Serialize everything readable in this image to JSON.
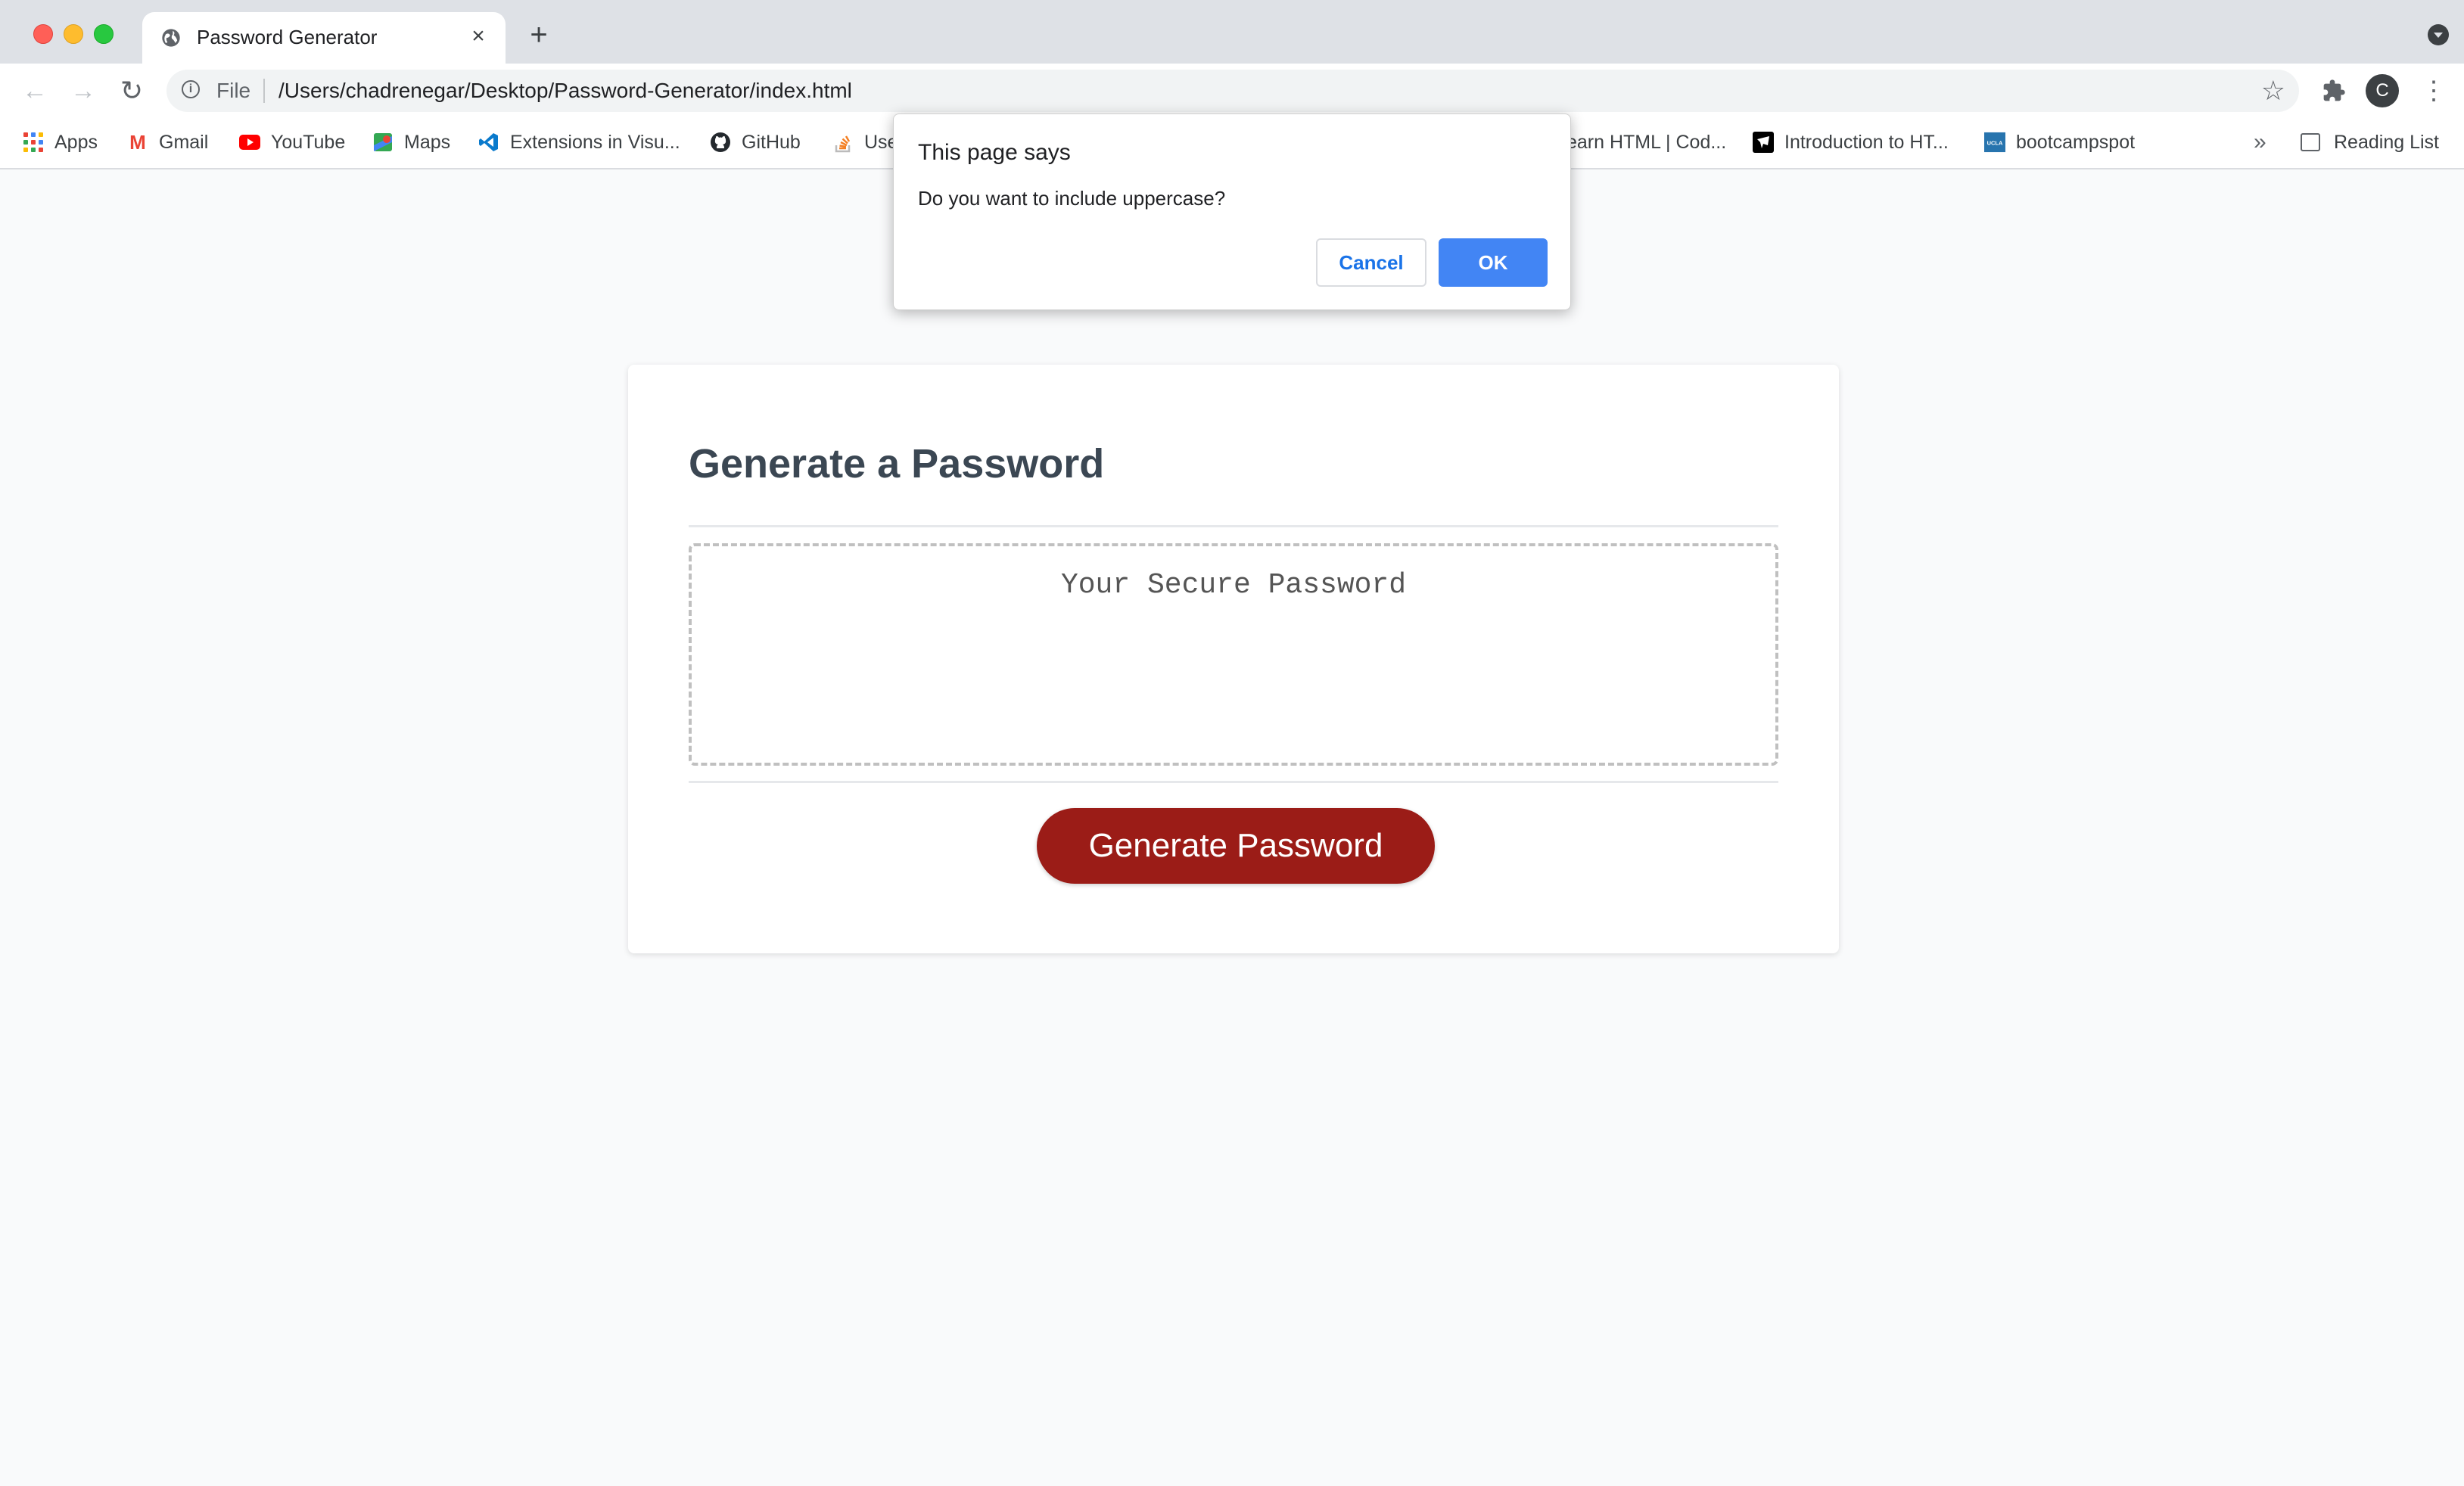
{
  "browser": {
    "tab": {
      "title": "Password Generator",
      "close": "×"
    },
    "new_tab": "+",
    "nav": {
      "back": "←",
      "forward": "→",
      "reload": "↻"
    },
    "omnibox": {
      "scheme_label": "File",
      "url": "/Users/chadrenegar/Desktop/Password-Generator/index.html"
    },
    "profile_initial": "C",
    "bookmarks": [
      {
        "label": "Apps",
        "icon": "apps-grid-icon"
      },
      {
        "label": "Gmail",
        "icon": "gmail-icon"
      },
      {
        "label": "YouTube",
        "icon": "youtube-icon"
      },
      {
        "label": "Maps",
        "icon": "maps-icon"
      },
      {
        "label": "Extensions in Visu...",
        "icon": "vscode-icon"
      },
      {
        "label": "GitHub",
        "icon": "github-icon"
      },
      {
        "label": "Use",
        "icon": "stackoverflow-icon"
      },
      {
        "label": "earn HTML | Cod...",
        "icon": ""
      },
      {
        "label": "Introduction to HT...",
        "icon": "codecademy-icon"
      },
      {
        "label": "bootcampspot",
        "icon": "ucla-icon"
      }
    ],
    "bookmarks_overflow": "»",
    "reading_list": "Reading List"
  },
  "page": {
    "heading": "Generate a Password",
    "password_placeholder": "Your Secure Password",
    "generate_button": "Generate Password"
  },
  "dialog": {
    "title": "This page says",
    "message": "Do you want to include uppercase?",
    "cancel": "Cancel",
    "ok": "OK"
  },
  "colors": {
    "button_red": "#9b1c17",
    "heading": "#3b4753",
    "dialog_ok": "#4285f4",
    "dialog_cancel_text": "#1a73e8"
  }
}
